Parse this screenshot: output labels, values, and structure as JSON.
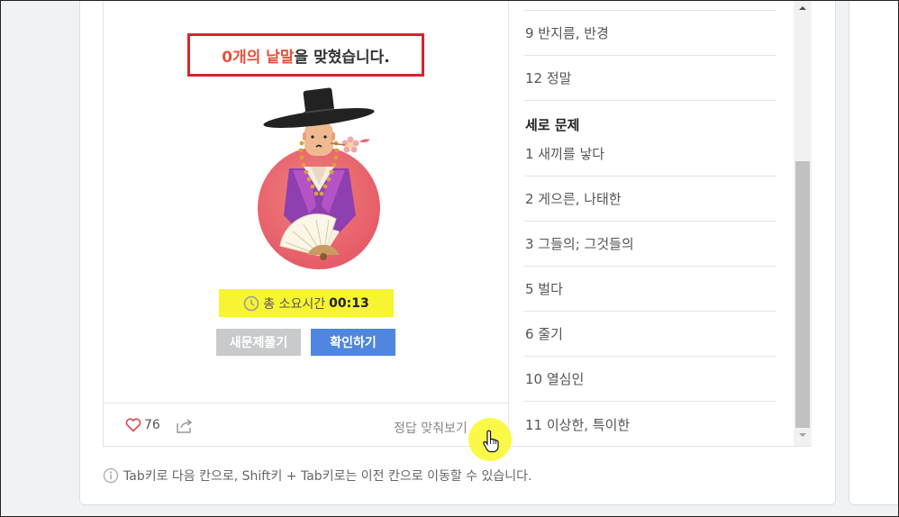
{
  "result": {
    "count_text": "0개의 낱말",
    "suffix_text": "을 맞혔습니다."
  },
  "timer": {
    "label": "총 소요시간",
    "value": "00:13"
  },
  "buttons": {
    "new_problem": "새문제풀기",
    "check": "확인하기",
    "show_answers": "정답 맞춰보기"
  },
  "footer": {
    "likes": "76"
  },
  "clues": {
    "across_tail": [
      {
        "label": "9 반지름, 반경"
      },
      {
        "label": "12 정말"
      }
    ],
    "down_heading": "세로 문제",
    "down": [
      {
        "label": "1 새끼를 낳다"
      },
      {
        "label": "2 게으른, 나태한"
      },
      {
        "label": "3 그들의; 그것들의"
      },
      {
        "label": "5 벌다"
      },
      {
        "label": "6 줄기"
      },
      {
        "label": "10 열심인"
      },
      {
        "label": "11 이상한, 특이한"
      }
    ]
  },
  "hint": {
    "text": "Tab키로 다음 칸으로, Shift키 + Tab키로는 이전 칸으로 이동할 수 있습니다."
  },
  "colors": {
    "accent_red": "#d3262c",
    "accent_blue": "#4f86df",
    "highlight_yellow": "#f7f532"
  }
}
